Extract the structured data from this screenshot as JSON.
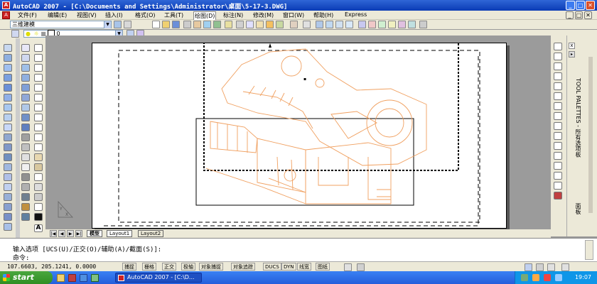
{
  "window": {
    "title": "AutoCAD 2007 - [C:\\Documents and Settings\\Administrator\\桌面\\5-17-3.DWG]",
    "controls": [
      "_",
      "□",
      "✕"
    ],
    "doc_controls": [
      "_",
      "□",
      "✕"
    ]
  },
  "menu": [
    "文件(F)",
    "编辑(E)",
    "视图(V)",
    "插入(I)",
    "格式(O)",
    "工具(T)",
    "绘图(D)",
    "标注(N)",
    "修改(M)",
    "窗口(W)",
    "帮助(H)",
    "Express"
  ],
  "workspace": {
    "value": "三维建模"
  },
  "layer": {
    "value": "0"
  },
  "tabs": [
    "模型",
    "Layout1",
    "Layout2"
  ],
  "tool_palettes": {
    "title": "TOOL PALETTES - 所有选项板",
    "bottom_label": "面板"
  },
  "command": {
    "line1": "输入选项 [UCS(U)/正交(O)/辅助(A)/截面(S)]:",
    "line2": "命令:"
  },
  "status": {
    "coords": "107.6603, 205.1241, 0.0000",
    "buttons": [
      "捕捉",
      "栅格",
      "正交",
      "极轴",
      "对象捕捉",
      "对象追踪",
      "DUCS",
      "DYN",
      "线宽",
      "图纸"
    ]
  },
  "taskbar": {
    "start": "start",
    "task": "AutoCAD 2007 - [C:\\D...",
    "clock": "19:07"
  },
  "colors": {
    "drawing_line": "#f0a060",
    "titlebar": "#0a3bb5",
    "taskbar": "#245edb"
  }
}
